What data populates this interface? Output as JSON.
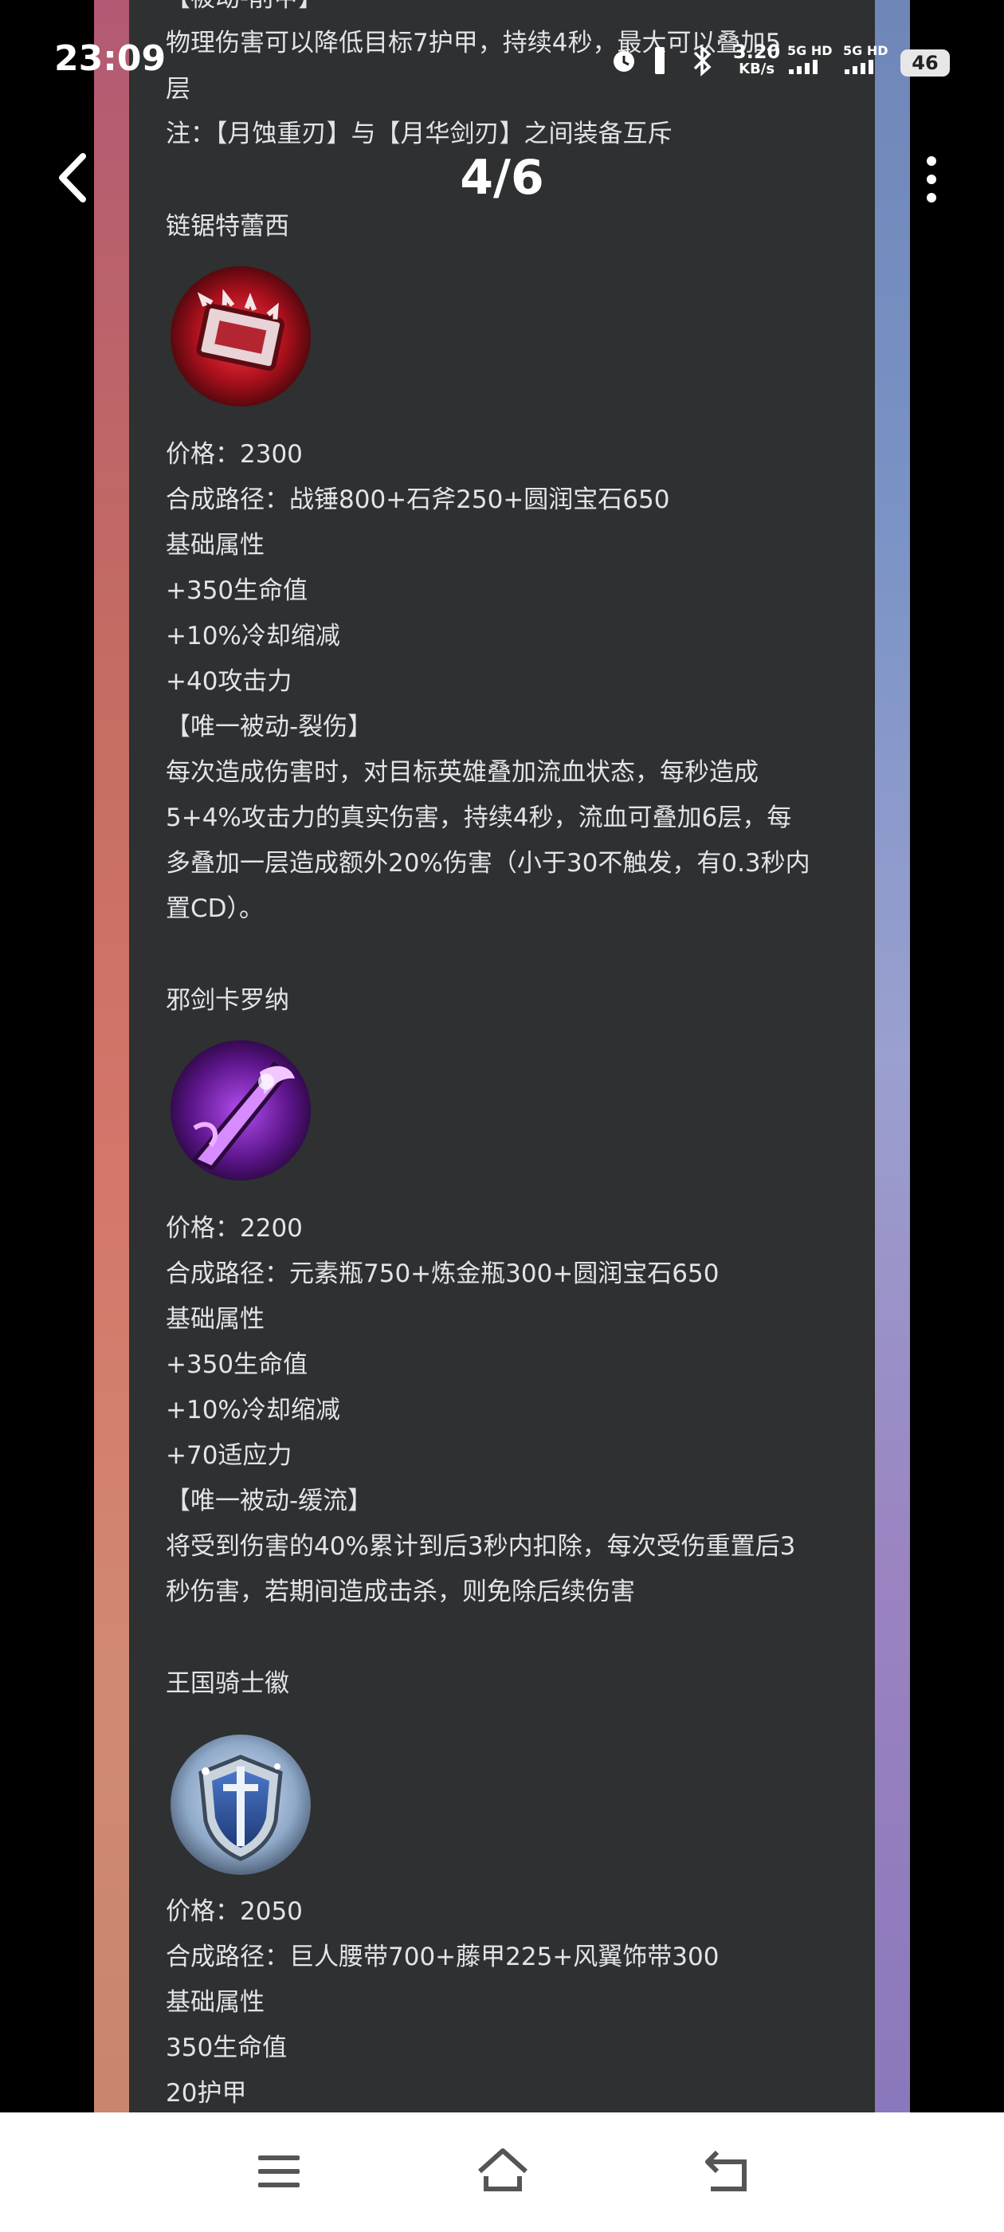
{
  "status_bar": {
    "time": "23:09",
    "net_speed_value": "3.20",
    "net_speed_unit": "KB/s",
    "sim1": "5G HD",
    "sim2": "5G HD",
    "battery": "46"
  },
  "viewer": {
    "page_indicator": "4/6"
  },
  "top_fragment": {
    "cut_line": "【被动-削甲】",
    "line1": "物理伤害可以降低目标7护甲，持续4秒，最大可以叠加5",
    "line2": "层",
    "note": "注：【月蚀重刃】与【月华剑刃】之间装备互斥"
  },
  "items": [
    {
      "name": "链锯特蕾西",
      "icon": "chainsaw-item-icon",
      "price": "价格：2300",
      "recipe": "合成路径：战锤800+石斧250+圆润宝石650",
      "base_header": "基础属性",
      "stats": [
        "+350生命值",
        "+10%冷却缩减",
        "+40攻击力"
      ],
      "passive_title": "【唯一被动-裂伤】",
      "passive_lines": [
        "每次造成伤害时，对目标英雄叠加流血状态，每秒造成",
        "5+4%攻击力的真实伤害，持续4秒，流血可叠加6层，每",
        "多叠加一层造成额外20%伤害（小于30不触发，有0.3秒内",
        "置CD）。"
      ]
    },
    {
      "name": "邪剑卡罗纳",
      "icon": "evil-sword-item-icon",
      "price": "价格：2200",
      "recipe": "合成路径：元素瓶750+炼金瓶300+圆润宝石650",
      "base_header": "基础属性",
      "stats": [
        "+350生命值",
        "+10%冷却缩减",
        "+70适应力"
      ],
      "passive_title": "【唯一被动-缓流】",
      "passive_lines": [
        "将受到伤害的40%累计到后3秒内扣除，每次受伤重置后3",
        "秒伤害，若期间造成击杀，则免除后续伤害"
      ]
    },
    {
      "name": "王国骑士徽",
      "icon": "knight-shield-item-icon",
      "price": "价格：2050",
      "recipe": "合成路径：巨人腰带700+藤甲225+风翼饰带300",
      "base_header": "基础属性",
      "stats": [
        "350生命值",
        "20护甲"
      ]
    }
  ],
  "colors": {
    "panel": "#2e3031",
    "text": "#e2e4e6",
    "left_strip": "#c46b63",
    "right_strip": "#8a8fc6"
  }
}
